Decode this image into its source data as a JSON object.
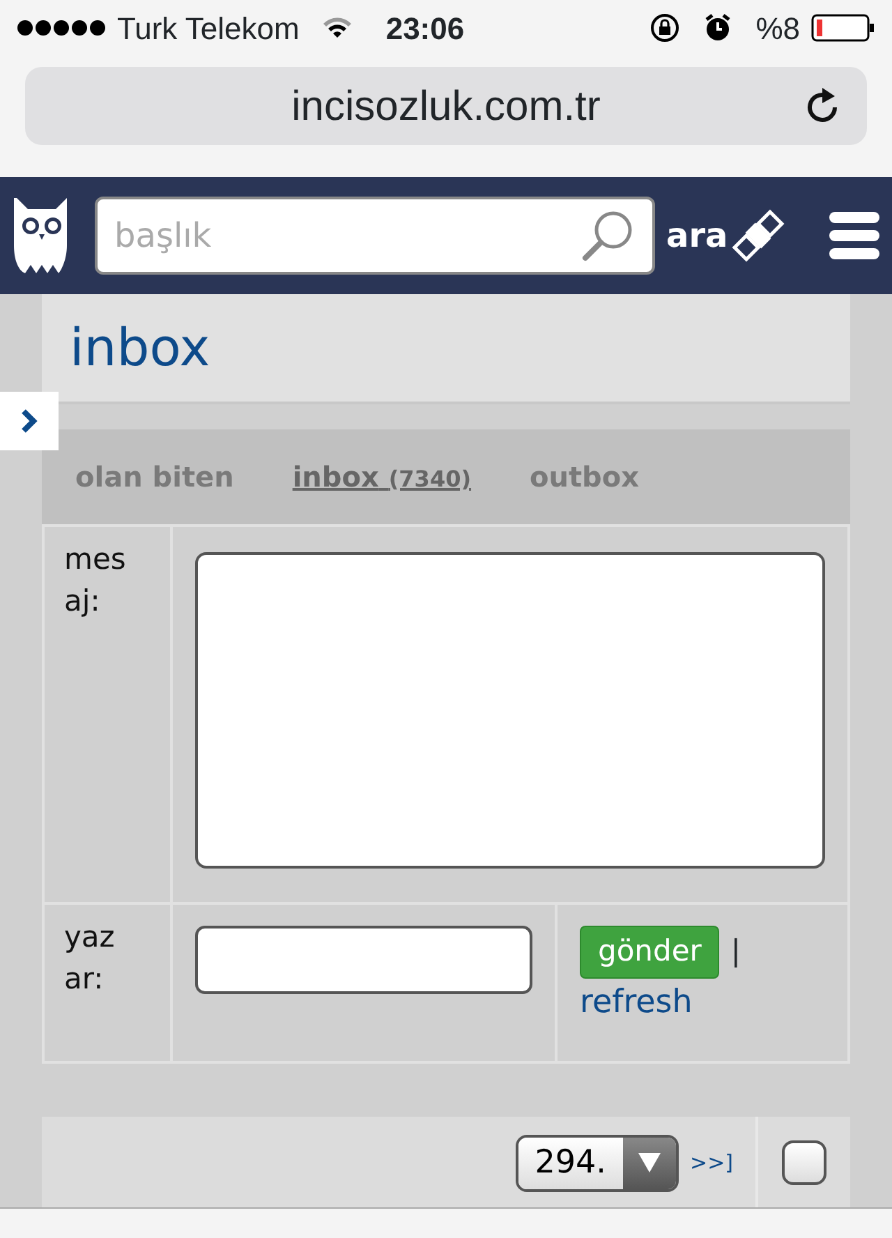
{
  "status_bar": {
    "carrier": "Turk Telekom",
    "time": "23:06",
    "battery": "%8"
  },
  "address_bar": {
    "url": "incisozluk.com.tr"
  },
  "navbar": {
    "search": {
      "placeholder": "başlık"
    },
    "search_button": "ara"
  },
  "page_title": "inbox",
  "tabs": [
    {
      "label": "olan biten",
      "selected": false
    },
    {
      "label": "inbox",
      "count": "(7340)",
      "selected": true
    },
    {
      "label": "outbox",
      "selected": false
    }
  ],
  "form": {
    "message_label": "mesaj:",
    "author_label": "yazar:",
    "send_button": "gönder",
    "separator": "|",
    "refresh_link": "refresh"
  },
  "pager": {
    "page": "294.",
    "next_link": ">>]",
    "checkbox": {
      "checked": false
    }
  }
}
